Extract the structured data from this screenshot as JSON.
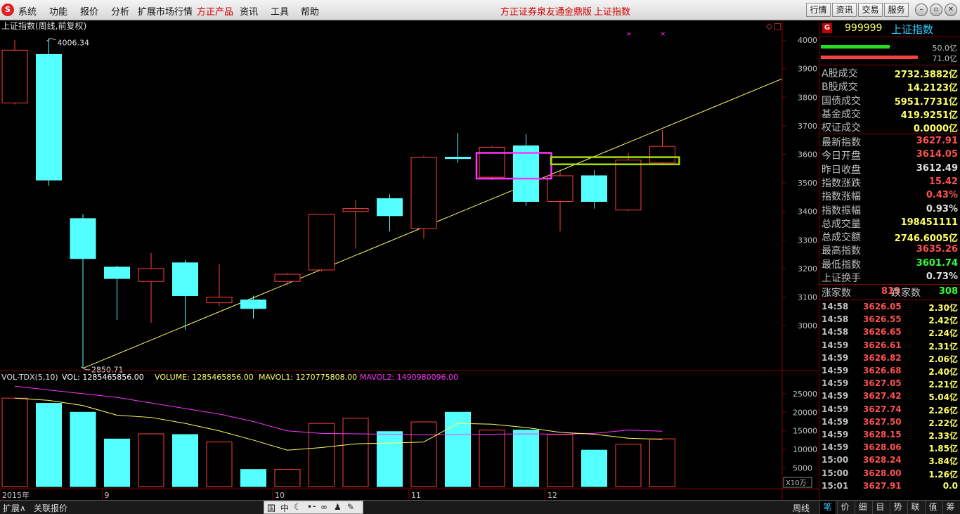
{
  "menubar": {
    "items": [
      "系统",
      "功能",
      "报价",
      "分析",
      "扩展市场行情",
      "方正产品",
      "资讯",
      "工具",
      "帮助"
    ],
    "active_item": "方正产品",
    "broker_title": "方正证券泉友通金鼎版",
    "index_title": "上证指数",
    "right_buttons": [
      "行情",
      "资讯",
      "交易",
      "服务"
    ]
  },
  "chart_header": {
    "title": "上证指数(周线,前复权)",
    "high_label": "4006.34",
    "low_label": "2850.71"
  },
  "colors": {
    "up": "#ff4040",
    "down": "#54ffff",
    "ma_yellow": "#ffff66",
    "ma_magenta": "#ff33ff",
    "axis_red": "#800000"
  },
  "chart_data": [
    {
      "type": "candlestick",
      "price_axis_ticks": [
        "4000",
        "3900",
        "3800",
        "3700",
        "3600",
        "3500",
        "3400",
        "3300",
        "3200",
        "3100",
        "3000"
      ],
      "ylim": [
        2850,
        4020
      ],
      "month_labels": [
        {
          "label": "2015年",
          "index": 0
        },
        {
          "label": "9",
          "index": 3
        },
        {
          "label": "10",
          "index": 8
        },
        {
          "label": "11",
          "index": 12
        },
        {
          "label": "12",
          "index": 16
        }
      ],
      "candles": [
        {
          "o": 3780,
          "h": 4000,
          "l": 3775,
          "c": 3965
        },
        {
          "o": 3950,
          "h": 4006.34,
          "l": 3490,
          "c": 3510
        },
        {
          "o": 3375,
          "h": 3390,
          "l": 2850.71,
          "c": 3235
        },
        {
          "o": 3205,
          "h": 3210,
          "l": 3020,
          "c": 3165
        },
        {
          "o": 3155,
          "h": 3255,
          "l": 3010,
          "c": 3200
        },
        {
          "o": 3220,
          "h": 3230,
          "l": 2985,
          "c": 3105
        },
        {
          "o": 3080,
          "h": 3215,
          "l": 3070,
          "c": 3100
        },
        {
          "o": 3090,
          "h": 3105,
          "l": 3025,
          "c": 3060
        },
        {
          "o": 3155,
          "h": 3185,
          "l": 3140,
          "c": 3180
        },
        {
          "o": 3195,
          "h": 3390,
          "l": 3190,
          "c": 3390
        },
        {
          "o": 3400,
          "h": 3440,
          "l": 3270,
          "c": 3410
        },
        {
          "o": 3445,
          "h": 3460,
          "l": 3330,
          "c": 3385
        },
        {
          "o": 3340,
          "h": 3595,
          "l": 3305,
          "c": 3590
        },
        {
          "o": 3590,
          "h": 3675,
          "l": 3570,
          "c": 3585
        },
        {
          "o": 3520,
          "h": 3630,
          "l": 3510,
          "c": 3625
        },
        {
          "o": 3630,
          "h": 3670,
          "l": 3420,
          "c": 3435
        },
        {
          "o": 3435,
          "h": 3540,
          "l": 3330,
          "c": 3525
        },
        {
          "o": 3525,
          "h": 3545,
          "l": 3410,
          "c": 3435
        },
        {
          "o": 3405,
          "h": 3605,
          "l": 3400,
          "c": 3580
        },
        {
          "o": 3570,
          "h": 3685,
          "l": 3565,
          "c": 3628
        }
      ],
      "trendline": {
        "from": {
          "index": 2,
          "value": 2850.71
        },
        "to_x_value": 3865
      }
    },
    {
      "type": "bar",
      "title": "VOL-TDX(5,10)",
      "legend": [
        {
          "text": "VOL: 1285465856.00",
          "color": "#ffffff"
        },
        {
          "text": "VOLUME: 1285465856.00",
          "color": "#ffff66"
        },
        {
          "text": "MAVOL1: 1270775808.00",
          "color": "#ffff66"
        },
        {
          "text": "MAVOL2: 1490980096.00",
          "color": "#ff33ff"
        }
      ],
      "unit_label": "X10万",
      "axis_ticks": [
        "25000",
        "20000",
        "15000",
        "10000",
        "5000"
      ],
      "ylim": [
        0,
        28000
      ],
      "values": [
        23800,
        22400,
        20000,
        12800,
        14200,
        14000,
        12000,
        4600,
        4600,
        17000,
        18400,
        14800,
        17400,
        20000,
        15200,
        15200,
        14000,
        9800,
        11400,
        12850
      ],
      "mavol1": [
        23800,
        23200,
        21800,
        19200,
        18600,
        17000,
        15000,
        12500,
        9800,
        10500,
        11500,
        11700,
        12000,
        17000,
        16800,
        15900,
        14600,
        14100,
        13000,
        12700
      ],
      "mavol2": [
        27000,
        26000,
        25000,
        24000,
        22500,
        21000,
        19500,
        17500,
        15000,
        14300,
        14200,
        14100,
        13900,
        14000,
        14100,
        14200,
        14100,
        14300,
        15200,
        14900
      ]
    }
  ],
  "annotations": {
    "magenta_box": {
      "from_index": 14,
      "to_index": 15,
      "low": 3515,
      "high": 3605
    },
    "green_box": {
      "from_index": 16,
      "to_index": 19,
      "low": 3565,
      "high": 3590
    }
  },
  "panel": {
    "badge": "G",
    "code": "999999",
    "name": "上证指数",
    "buy_bar_label": "50.0亿",
    "sell_bar_label": "71.0亿",
    "turnover": [
      {
        "label": "A股成交",
        "value": "2732.3882亿",
        "color": "#ffff66"
      },
      {
        "label": "B股成交",
        "value": "14.2123亿",
        "color": "#ffff66"
      },
      {
        "label": "国债成交",
        "value": "5951.7731亿",
        "color": "#ffff66"
      },
      {
        "label": "基金成交",
        "value": "419.9251亿",
        "color": "#ffff66"
      },
      {
        "label": "权证成交",
        "value": "0.0000亿",
        "color": "#ffff66"
      }
    ],
    "quote": [
      {
        "label": "最新指数",
        "value": "3627.91",
        "color": "#ff5050"
      },
      {
        "label": "今日开盘",
        "value": "3614.05",
        "color": "#ff5050"
      },
      {
        "label": "昨日收盘",
        "value": "3612.49",
        "color": "#e0e0e0"
      },
      {
        "label": "指数涨跌",
        "value": "15.42",
        "color": "#ff5050"
      },
      {
        "label": "指数涨幅",
        "value": "0.43%",
        "color": "#ff5050"
      },
      {
        "label": "指数振幅",
        "value": "0.93%",
        "color": "#e0e0e0"
      },
      {
        "label": "总成交量",
        "value": "198451111",
        "color": "#ffff66"
      },
      {
        "label": "总成交额",
        "value": "2746.6005亿",
        "color": "#ffff66"
      },
      {
        "label": "最高指数",
        "value": "3635.26",
        "color": "#ff5050"
      },
      {
        "label": "最低指数",
        "value": "3601.74",
        "color": "#33ff33"
      },
      {
        "label": "上证换手",
        "value": "0.73%",
        "color": "#e0e0e0"
      }
    ],
    "breadth": {
      "up_label": "涨家数",
      "up_value": "819",
      "down_label": "跌家数",
      "down_value": "308"
    },
    "ticks": [
      {
        "time": "14:58",
        "price": "3626.05",
        "vol": "2.30亿"
      },
      {
        "time": "14:58",
        "price": "3626.55",
        "vol": "2.42亿"
      },
      {
        "time": "14:58",
        "price": "3626.65",
        "vol": "2.24亿"
      },
      {
        "time": "14:59",
        "price": "3626.61",
        "vol": "2.31亿"
      },
      {
        "time": "14:59",
        "price": "3626.82",
        "vol": "2.06亿"
      },
      {
        "time": "14:59",
        "price": "3626.68",
        "vol": "2.40亿"
      },
      {
        "time": "14:59",
        "price": "3627.05",
        "vol": "2.21亿"
      },
      {
        "time": "14:59",
        "price": "3627.42",
        "vol": "5.04亿"
      },
      {
        "time": "14:59",
        "price": "3627.74",
        "vol": "2.26亿"
      },
      {
        "time": "14:59",
        "price": "3627.50",
        "vol": "2.22亿"
      },
      {
        "time": "14:59",
        "price": "3628.15",
        "vol": "2.33亿"
      },
      {
        "time": "14:59",
        "price": "3628.06",
        "vol": "1.85亿"
      },
      {
        "time": "15:00",
        "price": "3628.24",
        "vol": "3.84亿"
      },
      {
        "time": "15:00",
        "price": "3628.00",
        "vol": "1.26亿"
      },
      {
        "time": "15:01",
        "price": "3627.91",
        "vol": "0.0"
      }
    ]
  },
  "bottom": {
    "left_tabs": [
      "扩展∧",
      "关联报价"
    ],
    "mini_icons": [
      "国",
      "中",
      "☾",
      "•⁃",
      "∞",
      "♟",
      "✎"
    ],
    "period_label": "周线",
    "right_tabs": [
      "笔",
      "价",
      "细",
      "目",
      "势",
      "联",
      "值",
      "筹"
    ],
    "active_right_tab": "笔"
  }
}
